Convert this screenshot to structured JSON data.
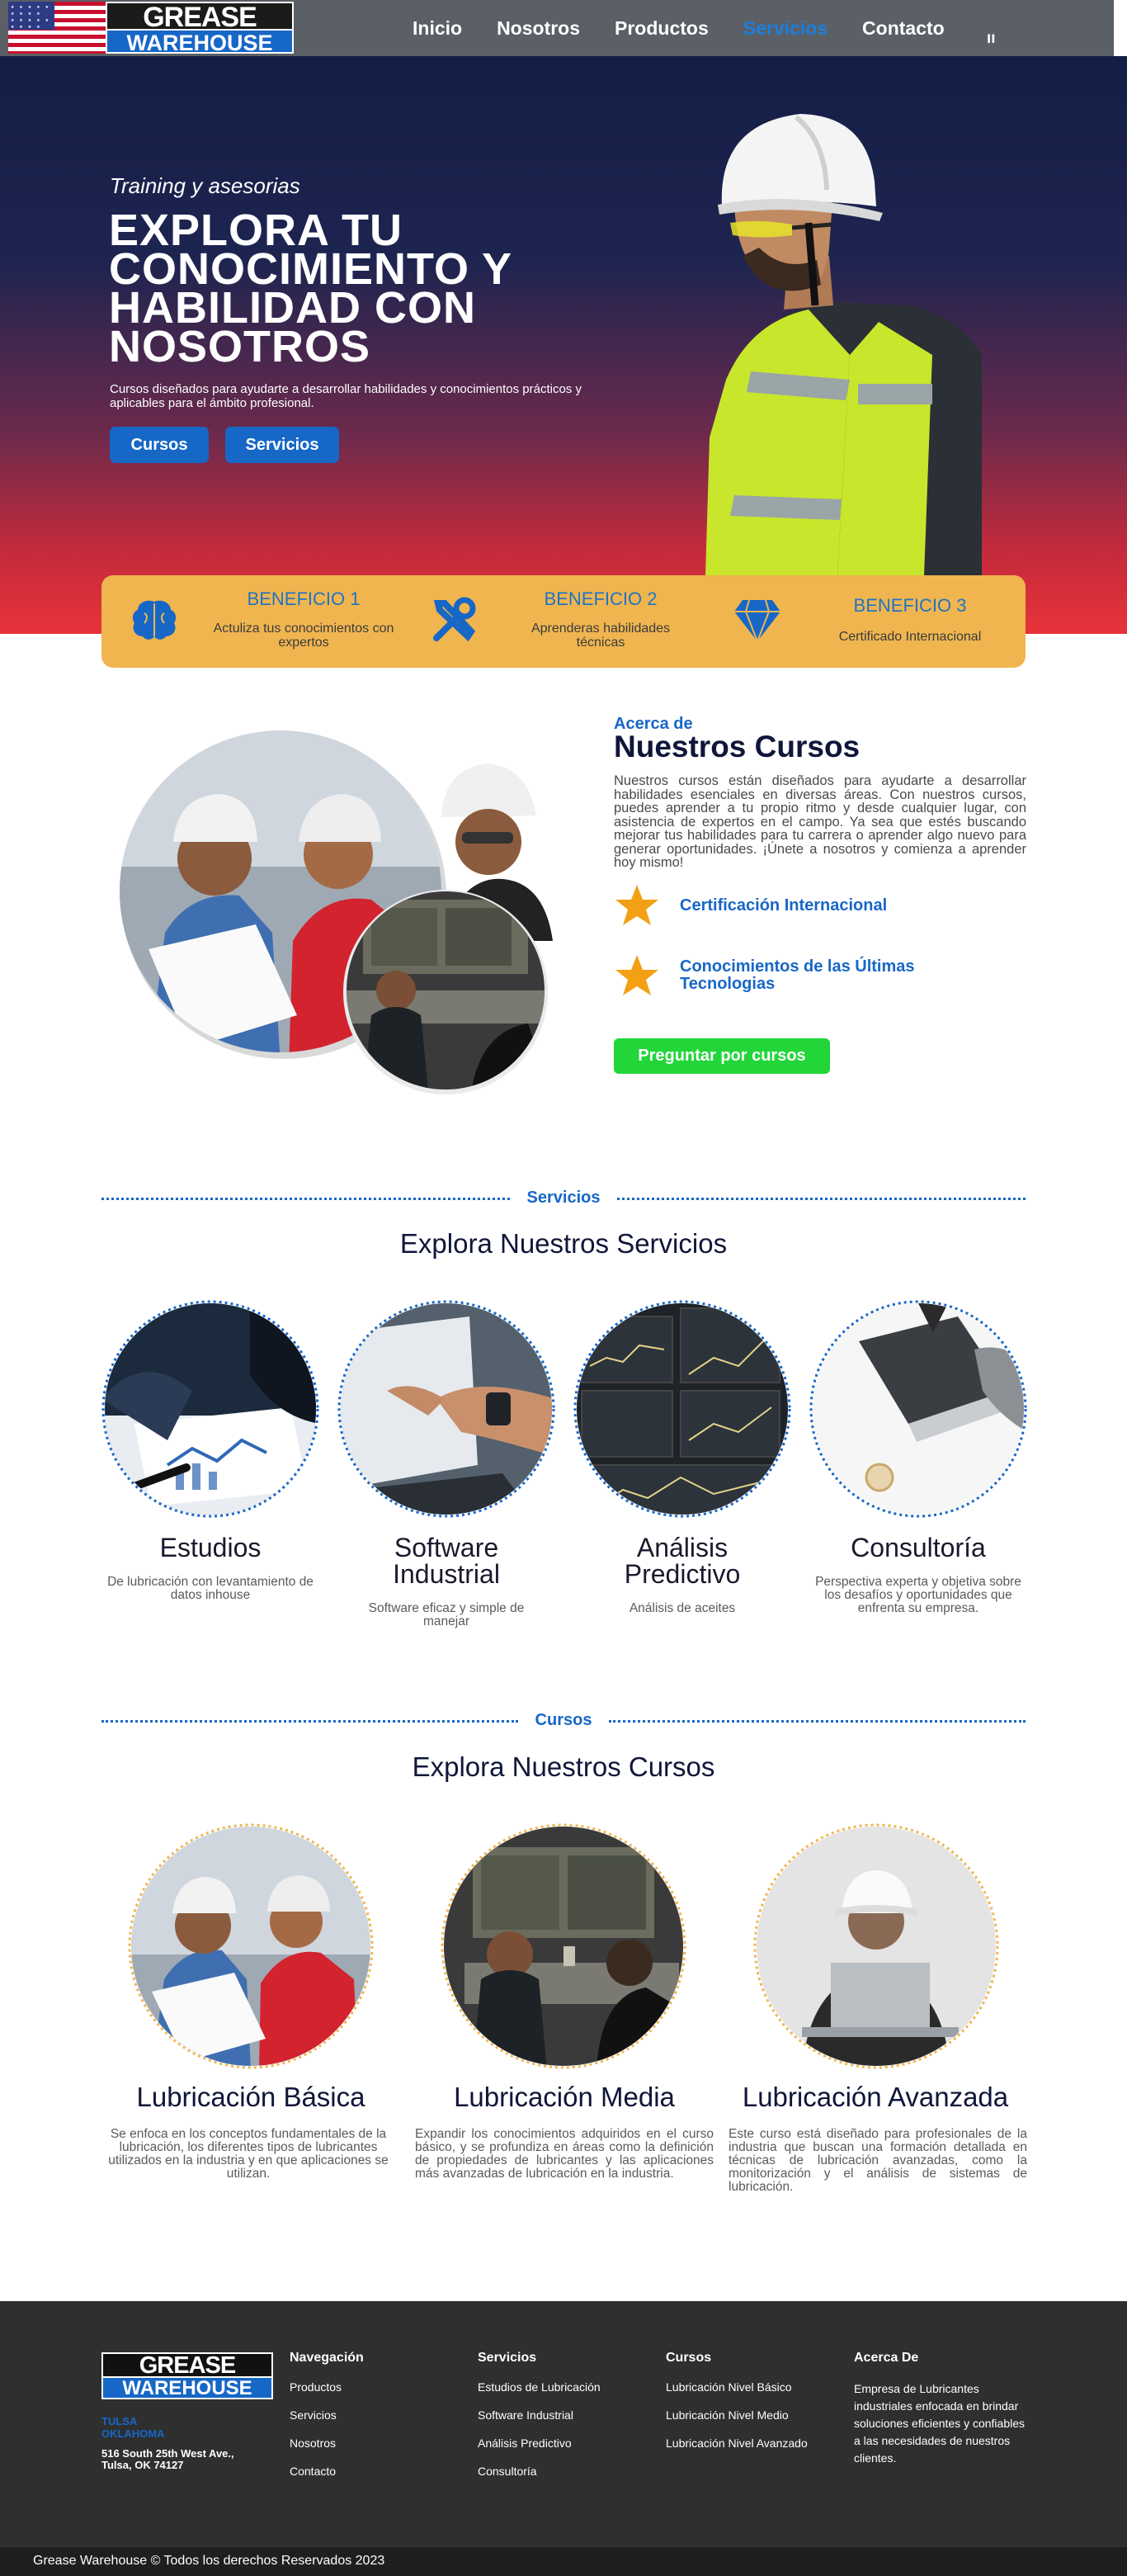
{
  "nav": {
    "logo_top": "GREASE",
    "logo_bottom": "WAREHOUSE",
    "links": [
      "Inicio",
      "Nosotros",
      "Productos",
      "Servicios",
      "Contacto"
    ],
    "active": "Servicios",
    "menu_toggle": "II"
  },
  "hero": {
    "subtitle": "Training y asesorias",
    "title": "EXPLORA TU CONOCIMIENTO Y HABILIDAD CON NOSOTROS",
    "description": "Cursos diseñados para ayudarte a desarrollar habilidades y conocimientos prácticos y aplicables para el ámbito profesional.",
    "btn_cursos": "Cursos",
    "btn_servicios": "Servicios"
  },
  "benefits": [
    {
      "title": "BENEFICIO 1",
      "desc": "Actuliza tus conocimientos con expertos",
      "icon": "brain-icon"
    },
    {
      "title": "BENEFICIO 2",
      "desc": "Aprenderas habilidades técnicas",
      "icon": "tools-icon"
    },
    {
      "title": "BENEFICIO 3",
      "desc": "Certificado Internacional",
      "icon": "diamond-icon"
    }
  ],
  "about": {
    "kicker": "Acerca de",
    "title": "Nuestros Cursos",
    "text": "Nuestros cursos están diseñados para ayudarte a desarrollar habilidades esenciales en diversas áreas. Con nuestros cursos, puedes aprender a tu propio ritmo y desde cualquier lugar, con asistencia de expertos en el campo. Ya sea que estés buscando mejorar tus habilidades para tu carrera o aprender algo nuevo para generar oportunidades. ¡Únete a nosotros y comienza a aprender hoy mismo!",
    "features": [
      "Certificación Internacional",
      "Conocimientos de las Últimas Tecnologias"
    ],
    "cta": "Preguntar por cursos"
  },
  "services": {
    "label": "Servicios",
    "title": "Explora Nuestros Servicios",
    "items": [
      {
        "name": "Estudios",
        "desc": "De lubricación con levantamiento de datos inhouse"
      },
      {
        "name": "Software Industrial",
        "desc": "Software eficaz y simple de manejar"
      },
      {
        "name": "Análisis Predictivo",
        "desc": "Análisis de aceites"
      },
      {
        "name": "Consultoría",
        "desc": "Perspectiva experta y objetiva sobre los desafíos y oportunidades que enfrenta su empresa."
      }
    ]
  },
  "courses": {
    "label": "Cursos",
    "title": "Explora Nuestros Cursos",
    "items": [
      {
        "name": "Lubricación Básica",
        "desc": "Se enfoca en los conceptos fundamentales de la lubricación, los diferentes tipos de lubricantes utilizados en la industria y en que aplicaciones se utilizan."
      },
      {
        "name": "Lubricación Media",
        "desc": "Expandir los conocimientos adquiridos en el curso básico, y se profundiza en áreas como la definición de propiedades de lubricantes y las aplicaciones más avanzadas de lubricación en la industria."
      },
      {
        "name": "Lubricación Avanzada",
        "desc": "Este curso está diseñado para profesionales de la industria que buscan una formación detallada en técnicas de lubricación avanzadas, como la monitorización y el análisis de sistemas de lubricación."
      }
    ]
  },
  "footer": {
    "logo_top": "GREASE",
    "logo_bottom": "WAREHOUSE",
    "city": "TULSA\nOKLAHOMA",
    "address": "516 South 25th West Ave.,\nTulsa, OK 74127",
    "nav_title": "Navegación",
    "nav_links": [
      "Productos",
      "Servicios",
      "Nosotros",
      "Contacto"
    ],
    "svc_title": "Servicios",
    "svc_links": [
      "Estudios de Lubricación",
      "Software Industrial",
      "Análisis Predictivo",
      "Consultoría"
    ],
    "course_title": "Cursos",
    "course_links": [
      "Lubricación Nivel Básico",
      "Lubricación Nivel Medio",
      "Lubricación Nivel Avanzado"
    ],
    "about_title": "Acerca De",
    "about_text": "Empresa de Lubricantes industriales enfocada en brindar soluciones eficientes y confiables a las necesidades de nuestros clientes.",
    "copyright": "Grease Warehouse © Todos los derechos Reservados 2023"
  },
  "colors": {
    "brand_blue": "#1767c7",
    "benefit_bar": "#f0b54f",
    "cta_green": "#22d63a",
    "nav_bg": "#5b5f66",
    "footer_bg": "#2f2f2f"
  }
}
